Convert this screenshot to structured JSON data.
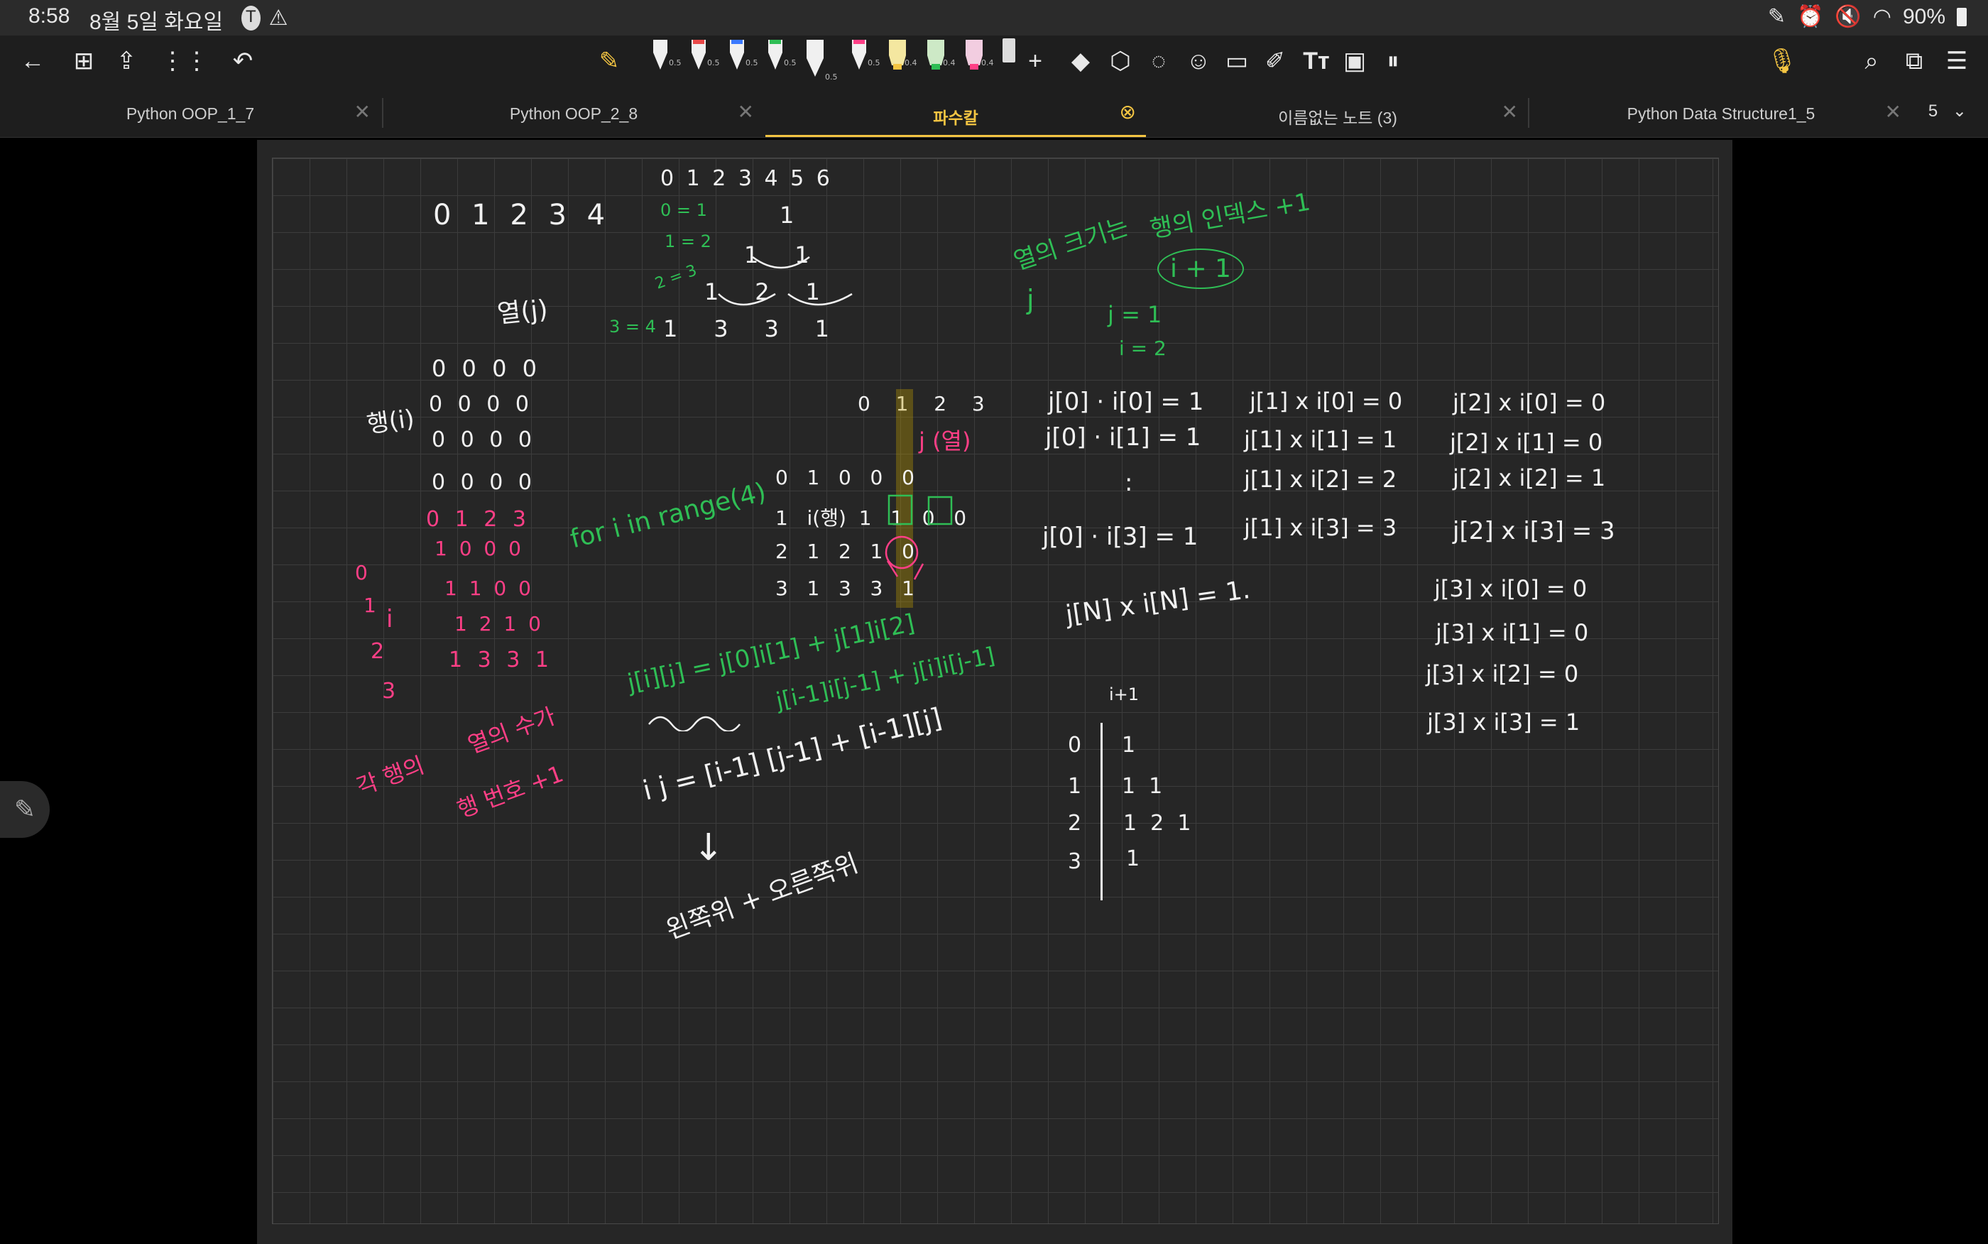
{
  "status": {
    "time": "8:58",
    "date": "8월 5일 화요일",
    "battery": "90%"
  },
  "toolbar": {
    "pen_sizes": [
      "0.5",
      "0.5",
      "0.5",
      "0.5",
      "0.5",
      "0.5",
      "0.4",
      "0.4",
      "0.4"
    ]
  },
  "tabs": [
    {
      "label": "Python OOP_1_7"
    },
    {
      "label": "Python OOP_2_8"
    },
    {
      "label": "파수칼",
      "active": true
    },
    {
      "label": "이름없는 노트 (3)"
    },
    {
      "label": "Python Data Structure1_5"
    }
  ],
  "tab_count": "5",
  "note": {
    "top_idx": "0 1 2 3 4",
    "col_idx": "0  1  2  3  4  5  6",
    "yeol": "열(j)",
    "haeng": "행(i)",
    "zeros": [
      "0  0  0  0",
      "0  0  0  0",
      "0  0  0  0",
      "0  0  0  0"
    ],
    "tri_rows": [
      "1",
      "1     1",
      "1     2     1",
      "1     3     3     1"
    ],
    "green_eq": [
      "0 = 1",
      "1 = 2",
      "2 = 3",
      "3 = 4"
    ],
    "for_loop": "for i in range(4)",
    "mid_header": "0  1  2  3",
    "mid_rows": [
      "0   1   0   0   0",
      "1   i(행)  1   1   0   0",
      "2   1   2   1   0",
      "3   1   3   3   1"
    ],
    "j_yeol": "j (열)",
    "pink_top": "0 1 2 3",
    "pink_rows": [
      "1 0 0 0",
      "1 1 0 0",
      "1 2 1 0",
      "1 3 3 1"
    ],
    "pink_side": [
      "0",
      "1",
      "2",
      "3"
    ],
    "pink_i": "i",
    "pink_note1": "각 행의",
    "pink_note2": "열의 수가",
    "pink_note3": "행 번호 +1",
    "green_formula1": "j[i][j] = j[0]i[1] + j[1]i[2]",
    "green_formula2": "j[i-1]i[j-1] + j[i]i[j-1]",
    "white_formula": "i j = [i-1] [j-1] + [i-1][j]",
    "arrow": "↓",
    "left_right": "왼쪽위 + 오른쪽위",
    "green_note1": "열의 크기는",
    "green_note2": "행의 인덱스 +1",
    "green_note3": "i + 1",
    "green_j": "j",
    "green_j1": "j = 1",
    "green_i2": "i = 2",
    "col1": [
      "j[0] · i[0] = 1",
      "j[0] · i[1] = 1",
      ":",
      "j[0] · i[3] = 1"
    ],
    "col2": [
      "j[1] x i[0] = 0",
      "j[1] x i[1] = 1",
      "j[1] x i[2] = 2",
      "j[1] x i[3] = 3"
    ],
    "col3": [
      "j[2] x i[0] = 0",
      "j[2] x i[1] = 0",
      "j[2] x i[2] = 1",
      "j[2] x i[3] = 3"
    ],
    "col4": [
      "j[3] x i[0] = 0",
      "j[3] x i[1] = 0",
      "j[3] x i[2] = 0",
      "j[3] x i[3] = 1"
    ],
    "jn": "j[N] x i[N] = 1.",
    "table_head": "i+1",
    "table_left": [
      "0",
      "1",
      "2",
      "3"
    ],
    "table_right": [
      "1",
      "1  1",
      "1  2  1",
      "1"
    ]
  }
}
